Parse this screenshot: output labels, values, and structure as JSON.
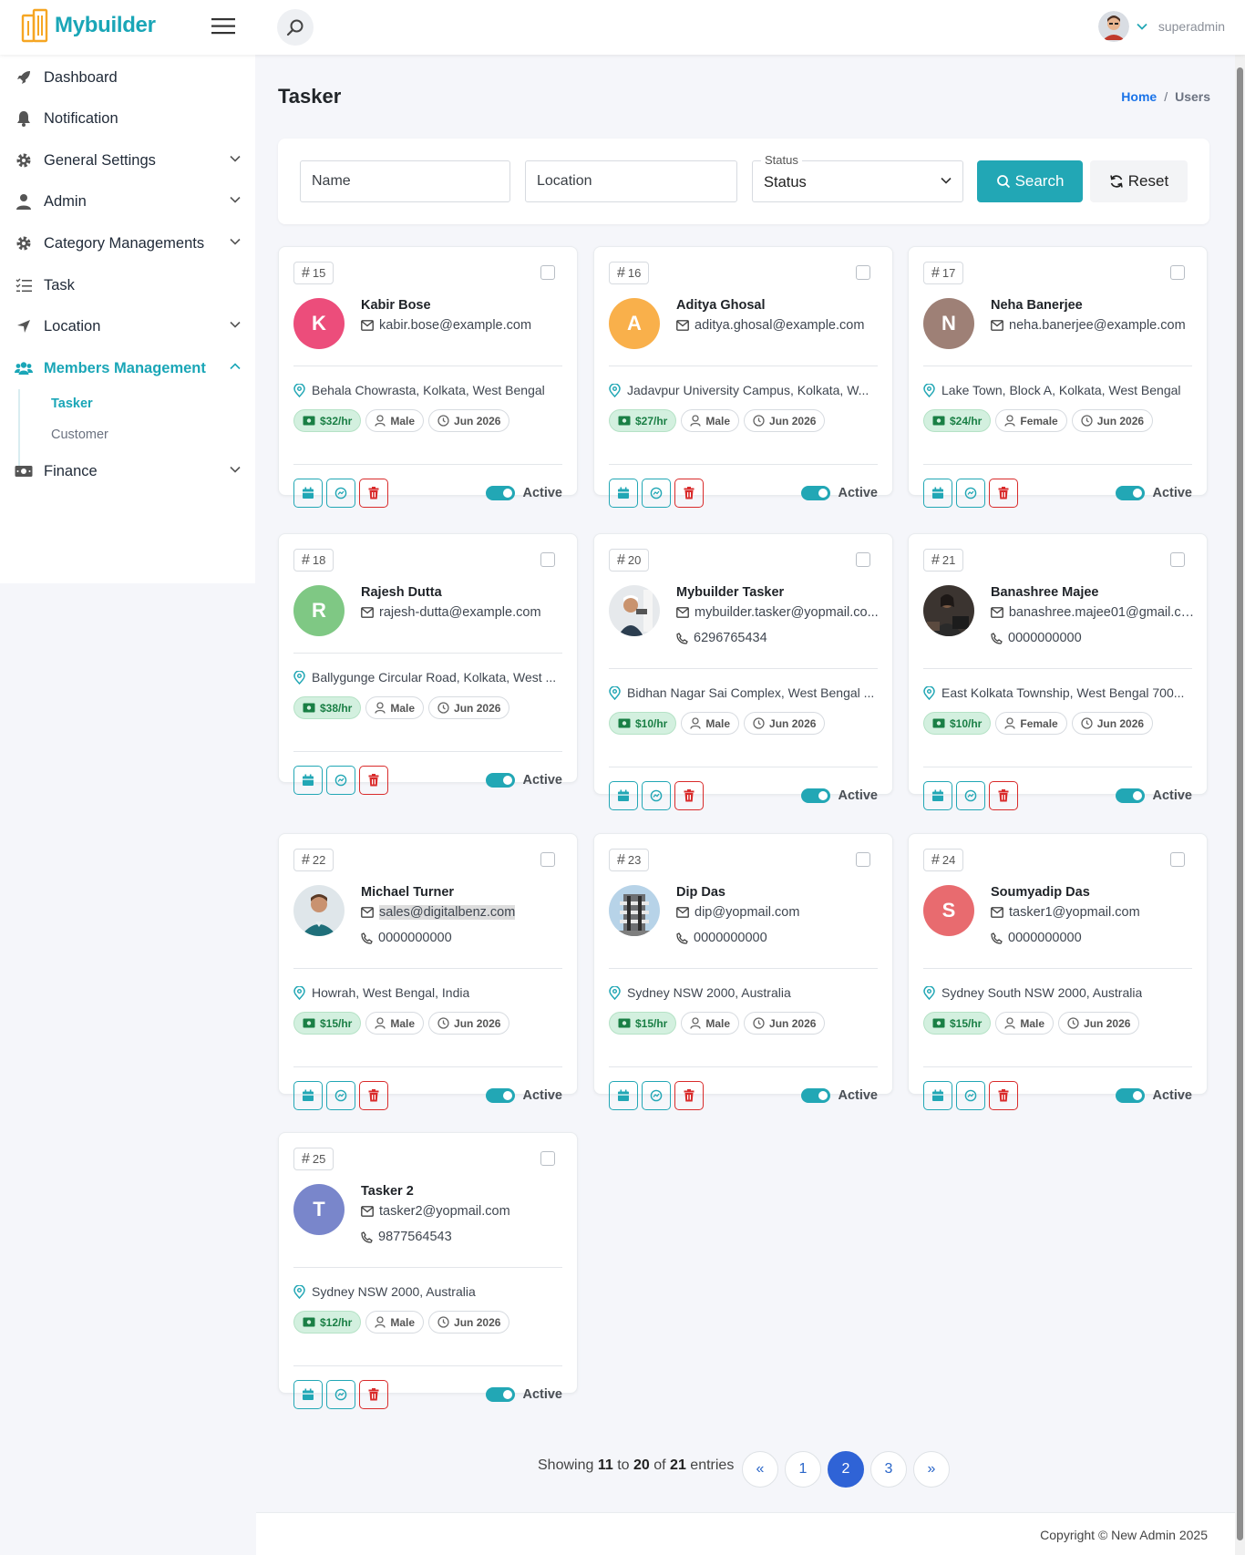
{
  "header": {
    "logo_text": "Mybuilder",
    "user_name": "superadmin",
    "brand_color": "#1aa6b7"
  },
  "sidebar": {
    "items": [
      {
        "label": "Dashboard",
        "icon": "rocket-icon"
      },
      {
        "label": "Notification",
        "icon": "bell-icon"
      },
      {
        "label": "General Settings",
        "icon": "gear-icon"
      },
      {
        "label": "Admin",
        "icon": "user-icon"
      },
      {
        "label": "Category Managements",
        "icon": "gear-icon"
      },
      {
        "label": "Task",
        "icon": "list-check-icon"
      },
      {
        "label": "Location",
        "icon": "location-arrow-icon"
      },
      {
        "label": "Members Management",
        "icon": "users-icon"
      },
      {
        "label": "Finance",
        "icon": "money-icon"
      }
    ],
    "sub_items": [
      {
        "label": "Tasker"
      },
      {
        "label": "Customer"
      }
    ]
  },
  "page": {
    "title": "Tasker",
    "breadcrumb_home": "Home",
    "breadcrumb_sep": "/",
    "breadcrumb_current": "Users"
  },
  "filters": {
    "name_placeholder": "Name",
    "location_placeholder": "Location",
    "status_legend": "Status",
    "status_value": "Status",
    "search_label": "Search",
    "reset_label": "Reset"
  },
  "cards": [
    {
      "id": "15",
      "name": "Kabir Bose",
      "email": "kabir.bose@example.com",
      "phone": "",
      "location": "Behala Chowrasta, Kolkata, West Bengal",
      "rate": "$32/hr",
      "gender": "Male",
      "date": "Jun 2026",
      "status": "Active",
      "initial": "K",
      "avatar_color": "#ec4d7b"
    },
    {
      "id": "16",
      "name": "Aditya Ghosal",
      "email": "aditya.ghosal@example.com",
      "phone": "",
      "location": "Jadavpur University Campus, Kolkata, W...",
      "rate": "$27/hr",
      "gender": "Male",
      "date": "Jun 2026",
      "status": "Active",
      "initial": "A",
      "avatar_color": "#f9b04b"
    },
    {
      "id": "17",
      "name": "Neha Banerjee",
      "email": "neha.banerjee@example.com",
      "phone": "",
      "location": "Lake Town, Block A, Kolkata, West Bengal",
      "rate": "$24/hr",
      "gender": "Female",
      "date": "Jun 2026",
      "status": "Active",
      "initial": "N",
      "avatar_color": "#9e8076"
    },
    {
      "id": "18",
      "name": "Rajesh Dutta",
      "email": "rajesh-dutta@example.com",
      "phone": "",
      "location": "Ballygunge Circular Road, Kolkata, West ...",
      "rate": "$38/hr",
      "gender": "Male",
      "date": "Jun 2026",
      "status": "Active",
      "initial": "R",
      "avatar_color": "#7fc884"
    },
    {
      "id": "20",
      "name": "Mybuilder Tasker",
      "email": "mybuilder.tasker@yopmail.co...",
      "phone": "6296765434",
      "location": "Bidhan Nagar Sai Complex, West Bengal ...",
      "rate": "$10/hr",
      "gender": "Male",
      "date": "Jun 2026",
      "status": "Active",
      "initial": "",
      "avatar_color": "#dfe3e8"
    },
    {
      "id": "21",
      "name": "Banashree Majee",
      "email": "banashree.majee01@gmail.co...",
      "phone": "0000000000",
      "location": "East Kolkata Township, West Bengal 700...",
      "rate": "$10/hr",
      "gender": "Female",
      "date": "Jun 2026",
      "status": "Active",
      "initial": "",
      "avatar_color": "#6b5a4e"
    },
    {
      "id": "22",
      "name": "Michael Turner",
      "email": "sales@digitalbenz.com",
      "phone": "0000000000",
      "location": "Howrah, West Bengal, India",
      "rate": "$15/hr",
      "gender": "Male",
      "date": "Jun 2026",
      "status": "Active",
      "initial": "",
      "avatar_color": "#cfd6dc"
    },
    {
      "id": "23",
      "name": "Dip Das",
      "email": "dip@yopmail.com",
      "phone": "0000000000",
      "location": "Sydney NSW 2000, Australia",
      "rate": "$15/hr",
      "gender": "Male",
      "date": "Jun 2026",
      "status": "Active",
      "initial": "",
      "avatar_color": "#b7d3e8"
    },
    {
      "id": "24",
      "name": "Soumyadip Das",
      "email": "tasker1@yopmail.com",
      "phone": "0000000000",
      "location": "Sydney South NSW 2000, Australia",
      "rate": "$15/hr",
      "gender": "Male",
      "date": "Jun 2026",
      "status": "Active",
      "initial": "S",
      "avatar_color": "#e86b6f"
    },
    {
      "id": "25",
      "name": "Tasker 2",
      "email": "tasker2@yopmail.com",
      "phone": "9877564543",
      "location": "Sydney NSW 2000, Australia",
      "rate": "$12/hr",
      "gender": "Male",
      "date": "Jun 2026",
      "status": "Active",
      "initial": "T",
      "avatar_color": "#7986cb"
    }
  ],
  "pagination": {
    "showing_word": "Showing",
    "from": "11",
    "to_word": "to",
    "to": "20",
    "of_word": "of",
    "total": "21",
    "entries_word": "entries",
    "prev_label": "«",
    "next_label": "»",
    "pages": [
      "1",
      "2",
      "3"
    ],
    "current_page": "2"
  },
  "footer": {
    "copyright": "Copyright © New Admin 2025"
  }
}
